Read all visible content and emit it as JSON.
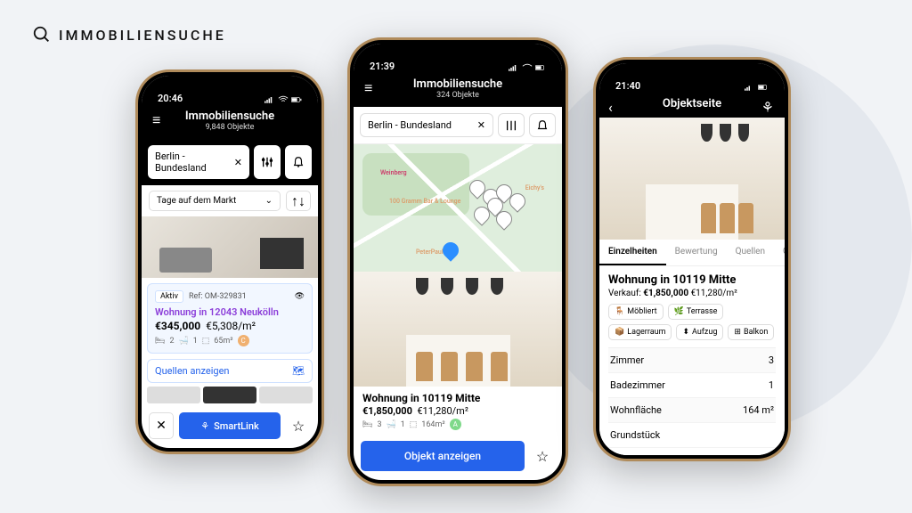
{
  "brand": "IMMOBILIENSUCHE",
  "phone1": {
    "time": "20:46",
    "title": "Immobiliensuche",
    "subtitle": "9,848 Objekte",
    "search_value": "Berlin - Bundesland",
    "filter_label": "Tage auf dem Markt",
    "card": {
      "status": "Aktiv",
      "ref": "Ref: OM-329831",
      "title": "Wohnung in 12043 Neukölln",
      "price": "€345,000",
      "ppm": "€5,308/m²",
      "beds": "2",
      "baths": "1",
      "area": "65m²",
      "badge": "C"
    },
    "sources_btn": "Quellen anzeigen",
    "smartlink": "SmartLink"
  },
  "phone2": {
    "time": "21:39",
    "title": "Immobiliensuche",
    "subtitle": "324 Objekte",
    "search_value": "Berlin - Bundesland",
    "map_labels": {
      "park": "Weinberg",
      "poi1": "100 Gramm Bar & Lounge",
      "poi2": "Eichy's",
      "poi3": "PeterPaul"
    },
    "listing": {
      "title": "Wohnung in 10119 Mitte",
      "price": "€1,850,000",
      "ppm": "€11,280/m²",
      "beds": "3",
      "baths": "1",
      "area": "164m²",
      "badge": "A"
    },
    "cta": "Objekt anzeigen"
  },
  "phone3": {
    "time": "21:40",
    "title": "Objektseite",
    "tabs": [
      "Einzelheiten",
      "Bewertung",
      "Quellen",
      "G"
    ],
    "heading": "Wohnung in 10119 Mitte",
    "sale_label": "Verkauf:",
    "price": "€1,850,000",
    "ppm": "€11,280/m²",
    "chips": [
      "Möbliert",
      "Terrasse",
      "Lagerraum",
      "Aufzug",
      "Balkon"
    ],
    "rows": [
      {
        "label": "Zimmer",
        "value": "3"
      },
      {
        "label": "Badezimmer",
        "value": "1"
      },
      {
        "label": "Wohnfläche",
        "value": "164 m²"
      },
      {
        "label": "Grundstück",
        "value": ""
      }
    ]
  }
}
